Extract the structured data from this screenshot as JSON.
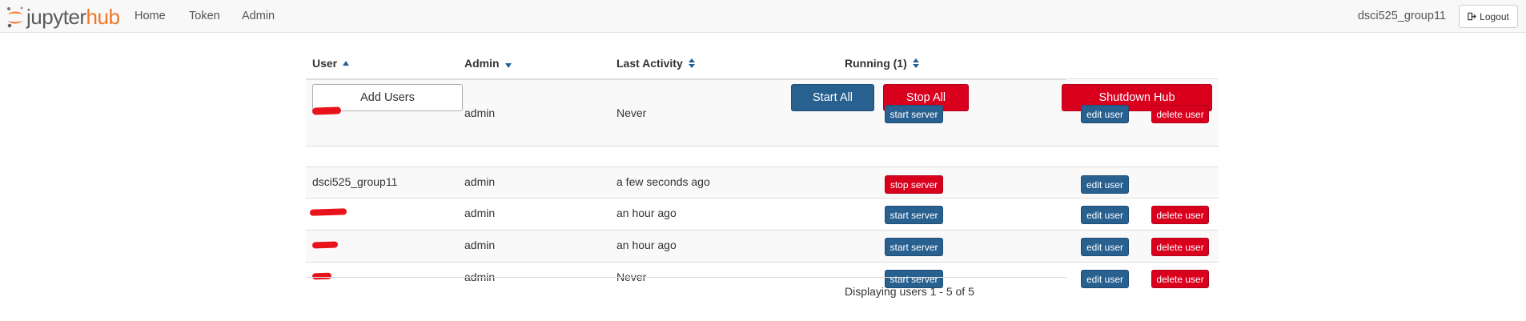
{
  "nav": {
    "logo_part1": "jupyter",
    "logo_part2": "hub",
    "links": [
      "Home",
      "Token",
      "Admin"
    ],
    "username": "dsci525_group11",
    "logout_label": "Logout"
  },
  "table": {
    "headers": {
      "user": "User",
      "admin": "Admin",
      "last_activity": "Last Activity",
      "running": "Running (1)"
    },
    "sort_icons": {
      "user": "sort-ascending-icon",
      "admin": "sort-descending-icon",
      "last_activity": "sort-both-icon",
      "running": "sort-both-icon"
    },
    "actions": {
      "add_users": "Add Users",
      "start_all": "Start All",
      "stop_all": "Stop All",
      "shutdown_hub": "Shutdown Hub"
    },
    "rows": [
      {
        "user": "",
        "user_redacted": true,
        "admin": "admin",
        "last_activity": "Never",
        "server_button": "start server",
        "edit": "edit user",
        "delete": "delete user"
      },
      {
        "user": "dsci525_group11",
        "user_redacted": false,
        "admin": "admin",
        "last_activity": "a few seconds ago",
        "server_button": "stop server",
        "edit": "edit user",
        "delete": ""
      },
      {
        "user": "",
        "user_redacted": true,
        "admin": "admin",
        "last_activity": "an hour ago",
        "server_button": "start server",
        "edit": "edit user",
        "delete": "delete user"
      },
      {
        "user": "",
        "user_redacted": true,
        "admin": "admin",
        "last_activity": "an hour ago",
        "server_button": "start server",
        "edit": "edit user",
        "delete": "delete user"
      },
      {
        "user": "",
        "user_redacted": true,
        "admin": "admin",
        "last_activity": "Never",
        "server_button": "start server",
        "edit": "edit user",
        "delete": "delete user"
      }
    ],
    "footer": "Displaying users 1 - 5 of 5"
  },
  "colors": {
    "primary": "#286090",
    "danger": "#d9001e",
    "brand_orange": "#f37626",
    "redaction": "#e8121b"
  }
}
